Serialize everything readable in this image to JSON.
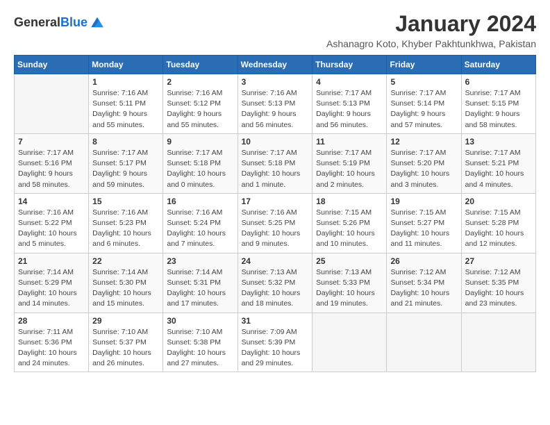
{
  "header": {
    "logo_general": "General",
    "logo_blue": "Blue",
    "month_year": "January 2024",
    "location": "Ashanagro Koto, Khyber Pakhtunkhwa, Pakistan"
  },
  "weekdays": [
    "Sunday",
    "Monday",
    "Tuesday",
    "Wednesday",
    "Thursday",
    "Friday",
    "Saturday"
  ],
  "weeks": [
    [
      {
        "day": "",
        "info": ""
      },
      {
        "day": "1",
        "info": "Sunrise: 7:16 AM\nSunset: 5:11 PM\nDaylight: 9 hours\nand 55 minutes."
      },
      {
        "day": "2",
        "info": "Sunrise: 7:16 AM\nSunset: 5:12 PM\nDaylight: 9 hours\nand 55 minutes."
      },
      {
        "day": "3",
        "info": "Sunrise: 7:16 AM\nSunset: 5:13 PM\nDaylight: 9 hours\nand 56 minutes."
      },
      {
        "day": "4",
        "info": "Sunrise: 7:17 AM\nSunset: 5:13 PM\nDaylight: 9 hours\nand 56 minutes."
      },
      {
        "day": "5",
        "info": "Sunrise: 7:17 AM\nSunset: 5:14 PM\nDaylight: 9 hours\nand 57 minutes."
      },
      {
        "day": "6",
        "info": "Sunrise: 7:17 AM\nSunset: 5:15 PM\nDaylight: 9 hours\nand 58 minutes."
      }
    ],
    [
      {
        "day": "7",
        "info": "Sunrise: 7:17 AM\nSunset: 5:16 PM\nDaylight: 9 hours\nand 58 minutes."
      },
      {
        "day": "8",
        "info": "Sunrise: 7:17 AM\nSunset: 5:17 PM\nDaylight: 9 hours\nand 59 minutes."
      },
      {
        "day": "9",
        "info": "Sunrise: 7:17 AM\nSunset: 5:18 PM\nDaylight: 10 hours\nand 0 minutes."
      },
      {
        "day": "10",
        "info": "Sunrise: 7:17 AM\nSunset: 5:18 PM\nDaylight: 10 hours\nand 1 minute."
      },
      {
        "day": "11",
        "info": "Sunrise: 7:17 AM\nSunset: 5:19 PM\nDaylight: 10 hours\nand 2 minutes."
      },
      {
        "day": "12",
        "info": "Sunrise: 7:17 AM\nSunset: 5:20 PM\nDaylight: 10 hours\nand 3 minutes."
      },
      {
        "day": "13",
        "info": "Sunrise: 7:17 AM\nSunset: 5:21 PM\nDaylight: 10 hours\nand 4 minutes."
      }
    ],
    [
      {
        "day": "14",
        "info": "Sunrise: 7:16 AM\nSunset: 5:22 PM\nDaylight: 10 hours\nand 5 minutes."
      },
      {
        "day": "15",
        "info": "Sunrise: 7:16 AM\nSunset: 5:23 PM\nDaylight: 10 hours\nand 6 minutes."
      },
      {
        "day": "16",
        "info": "Sunrise: 7:16 AM\nSunset: 5:24 PM\nDaylight: 10 hours\nand 7 minutes."
      },
      {
        "day": "17",
        "info": "Sunrise: 7:16 AM\nSunset: 5:25 PM\nDaylight: 10 hours\nand 9 minutes."
      },
      {
        "day": "18",
        "info": "Sunrise: 7:15 AM\nSunset: 5:26 PM\nDaylight: 10 hours\nand 10 minutes."
      },
      {
        "day": "19",
        "info": "Sunrise: 7:15 AM\nSunset: 5:27 PM\nDaylight: 10 hours\nand 11 minutes."
      },
      {
        "day": "20",
        "info": "Sunrise: 7:15 AM\nSunset: 5:28 PM\nDaylight: 10 hours\nand 12 minutes."
      }
    ],
    [
      {
        "day": "21",
        "info": "Sunrise: 7:14 AM\nSunset: 5:29 PM\nDaylight: 10 hours\nand 14 minutes."
      },
      {
        "day": "22",
        "info": "Sunrise: 7:14 AM\nSunset: 5:30 PM\nDaylight: 10 hours\nand 15 minutes."
      },
      {
        "day": "23",
        "info": "Sunrise: 7:14 AM\nSunset: 5:31 PM\nDaylight: 10 hours\nand 17 minutes."
      },
      {
        "day": "24",
        "info": "Sunrise: 7:13 AM\nSunset: 5:32 PM\nDaylight: 10 hours\nand 18 minutes."
      },
      {
        "day": "25",
        "info": "Sunrise: 7:13 AM\nSunset: 5:33 PM\nDaylight: 10 hours\nand 19 minutes."
      },
      {
        "day": "26",
        "info": "Sunrise: 7:12 AM\nSunset: 5:34 PM\nDaylight: 10 hours\nand 21 minutes."
      },
      {
        "day": "27",
        "info": "Sunrise: 7:12 AM\nSunset: 5:35 PM\nDaylight: 10 hours\nand 23 minutes."
      }
    ],
    [
      {
        "day": "28",
        "info": "Sunrise: 7:11 AM\nSunset: 5:36 PM\nDaylight: 10 hours\nand 24 minutes."
      },
      {
        "day": "29",
        "info": "Sunrise: 7:10 AM\nSunset: 5:37 PM\nDaylight: 10 hours\nand 26 minutes."
      },
      {
        "day": "30",
        "info": "Sunrise: 7:10 AM\nSunset: 5:38 PM\nDaylight: 10 hours\nand 27 minutes."
      },
      {
        "day": "31",
        "info": "Sunrise: 7:09 AM\nSunset: 5:39 PM\nDaylight: 10 hours\nand 29 minutes."
      },
      {
        "day": "",
        "info": ""
      },
      {
        "day": "",
        "info": ""
      },
      {
        "day": "",
        "info": ""
      }
    ]
  ]
}
